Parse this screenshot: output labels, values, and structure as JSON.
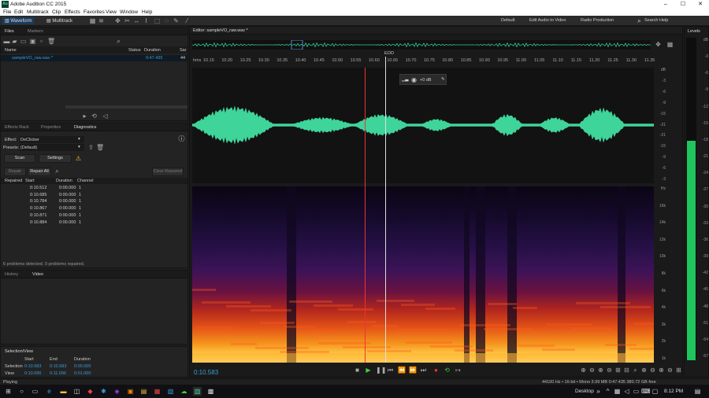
{
  "app": {
    "title": "Adobe Audition CC 2015",
    "logo": "Au"
  },
  "menu": [
    "File",
    "Edit",
    "Multitrack",
    "Clip",
    "Effects",
    "Favorites",
    "View",
    "Window",
    "Help"
  ],
  "toolbar": {
    "waveform_label": "Waveform",
    "multitrack_label": "Multitrack",
    "workspaces": [
      "Default",
      "Edit Audio to Video",
      "Radio Production"
    ],
    "search_help": "Search Help"
  },
  "files_panel": {
    "tabs": [
      "Files",
      "Markers"
    ],
    "columns": {
      "name": "Name",
      "status": "Status",
      "duration": "Duration",
      "sample": "Sar"
    },
    "items": [
      {
        "name": "sampleVO_raw.wav *",
        "duration": "0:47.435",
        "sample": "44"
      }
    ]
  },
  "mid_panel": {
    "tabs": [
      "Effects Rack",
      "Properties",
      "Diagnostics"
    ],
    "effect_label": "Effect:",
    "effect_value": "DeClicker",
    "presets_label": "Presets:",
    "presets_value": "(Default)",
    "scan_label": "Scan",
    "settings_label": "Settings",
    "repair_label": "Repair",
    "repair_all_label": "Repair All",
    "clear_label": "Clear Repaired",
    "columns": {
      "repaired": "Repaired",
      "start": "Start",
      "duration": "Duration",
      "channel": "Channel"
    },
    "rows": [
      {
        "start": "0:10.512",
        "duration": "0:00.000",
        "channel": "1"
      },
      {
        "start": "0:10.685",
        "duration": "0:00.000",
        "channel": "1"
      },
      {
        "start": "0:10.784",
        "duration": "0:00.000",
        "channel": "1"
      },
      {
        "start": "0:10.867",
        "duration": "0:00.000",
        "channel": "1"
      },
      {
        "start": "0:10.871",
        "duration": "0:00.000",
        "channel": "1"
      },
      {
        "start": "0:10.884",
        "duration": "0:00.000",
        "channel": "1"
      }
    ],
    "summary": "6 problems detected. 0 problems repaired."
  },
  "history_panel": {
    "tabs": [
      "History",
      "Video"
    ]
  },
  "selection_panel": {
    "title": "Selection/View",
    "columns": {
      "start": "Start",
      "end": "End",
      "duration": "Duration"
    },
    "selection": {
      "label": "Selection",
      "start": "0:10.583",
      "end": "0:10.583",
      "duration": "0:00.000"
    },
    "view": {
      "label": "View",
      "start": "0:10.096",
      "end": "0:11.096",
      "duration": "0:01.000"
    }
  },
  "editor": {
    "title": "Editor: sampleVO_raw.wav *",
    "ruler_unit": "hms",
    "ruler_ticks": [
      "10.15",
      "10.20",
      "10.25",
      "10.30",
      "10.35",
      "10.40",
      "10.45",
      "10.50",
      "10.55",
      "10.60",
      "10.65",
      "10.70",
      "10.75",
      "10.80",
      "10.85",
      "10.90",
      "10.95",
      "11.00",
      "11.05",
      "11.10",
      "11.15",
      "11.20",
      "11.25",
      "11.30",
      "11.35"
    ],
    "eod_label": "EOD",
    "hud_value": "+0 dB",
    "db_labels": [
      "dB",
      "-3",
      "-6",
      "-9",
      "-15",
      "-21",
      "-21",
      "-15",
      "-9",
      "-6",
      "-3"
    ],
    "hz_labels": [
      "Hz",
      "16k",
      "14k",
      "12k",
      "10k",
      "8k",
      "6k",
      "4k",
      "3k",
      "2k",
      "1k"
    ],
    "current_time": "0:10.583"
  },
  "levels": {
    "title": "Levels",
    "scale": [
      "dB",
      "-3",
      "-6",
      "-9",
      "-12",
      "-15",
      "-18",
      "-21",
      "-24",
      "-27",
      "-30",
      "-33",
      "-36",
      "-39",
      "-42",
      "-45",
      "-48",
      "-51",
      "-54",
      "-57"
    ],
    "fill": 0.68
  },
  "status": {
    "left": "Playing",
    "right": "44100 Hz • 16-bit • Mono    3.99 MB    0:47.435    380.72 GB free"
  },
  "taskbar": {
    "desktop_label": "Desktop",
    "time": "8:12 PM"
  }
}
